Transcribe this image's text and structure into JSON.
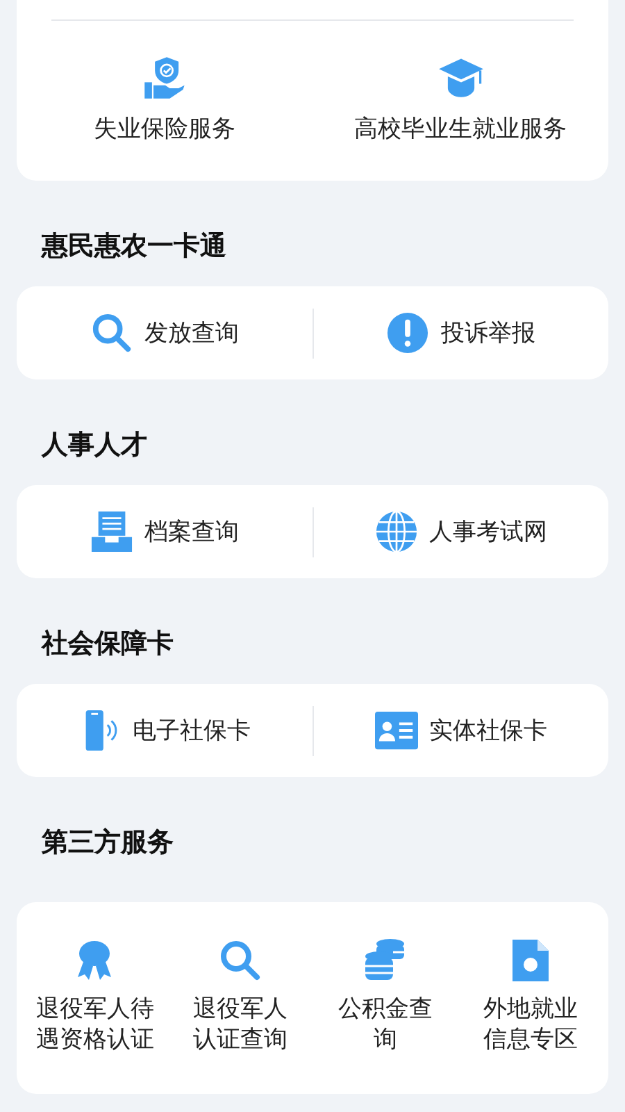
{
  "top_card": {
    "items": [
      {
        "label": "失业保险服务"
      },
      {
        "label": "高校毕业生就业服务"
      }
    ]
  },
  "sections": [
    {
      "title": "惠民惠农一卡通",
      "kind": "row",
      "items": [
        {
          "label": "发放查询"
        },
        {
          "label": "投诉举报"
        }
      ]
    },
    {
      "title": "人事人才",
      "kind": "row",
      "items": [
        {
          "label": "档案查询"
        },
        {
          "label": "人事考试网"
        }
      ]
    },
    {
      "title": "社会保障卡",
      "kind": "row",
      "items": [
        {
          "label": "电子社保卡"
        },
        {
          "label": "实体社保卡"
        }
      ]
    },
    {
      "title": "第三方服务",
      "kind": "grid",
      "items": [
        {
          "label": "退役军人待遇资格认证"
        },
        {
          "label": "退役军人认证查询"
        },
        {
          "label": "公积金查询"
        },
        {
          "label": "外地就业信息专区"
        }
      ]
    }
  ]
}
